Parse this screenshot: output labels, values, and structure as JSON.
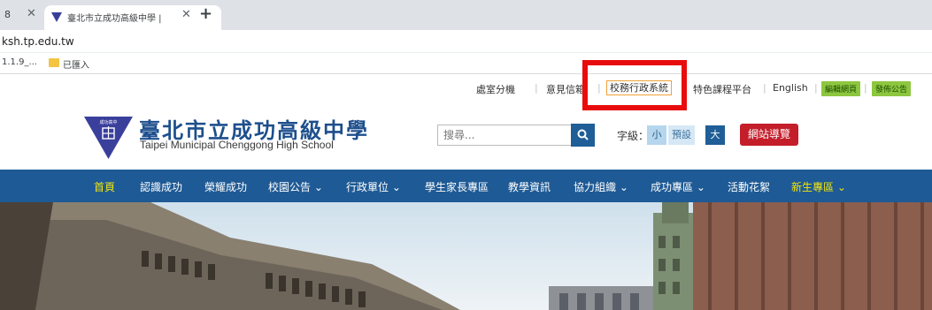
{
  "browser": {
    "prev_tab_fragment": "8",
    "active_tab_title": "臺北市立成功高級中學 |",
    "url": "ksh.tp.edu.tw",
    "bookmarks": [
      "1.1.9_...",
      "已匯入"
    ]
  },
  "toplinks": {
    "office_ext": "處室分機",
    "opinion": "意見信箱",
    "admin_system": "校務行政系統",
    "course_platform": "特色課程平台",
    "english": "English",
    "edit_page": "編輯網頁",
    "post_notice": "發佈公告"
  },
  "header": {
    "school_name": "臺北市立成功高級中學",
    "school_name_en": "Taipei Municipal Chenggong High School",
    "badge_text": "成功高中"
  },
  "search": {
    "placeholder": "搜尋..."
  },
  "font_size": {
    "label": "字級：",
    "small": "小",
    "default": "預設",
    "large": "大"
  },
  "sitemap_label": "網站導覽",
  "nav": [
    {
      "label": "首頁",
      "highlight": true
    },
    {
      "label": "認識成功"
    },
    {
      "label": "榮耀成功"
    },
    {
      "label": "校園公告 ⌄"
    },
    {
      "label": "行政單位 ⌄"
    },
    {
      "label": "學生家長專區"
    },
    {
      "label": "教學資訊"
    },
    {
      "label": "協力組織 ⌄"
    },
    {
      "label": "成功專區 ⌄"
    },
    {
      "label": "活動花絮"
    },
    {
      "label": "新生專區 ⌄",
      "highlight": true
    }
  ],
  "colors": {
    "nav_bg": "#1e5a95",
    "highlight": "#f3e60c",
    "sitemap_btn": "#c41e2a",
    "annotation_red": "#e80c0c"
  }
}
